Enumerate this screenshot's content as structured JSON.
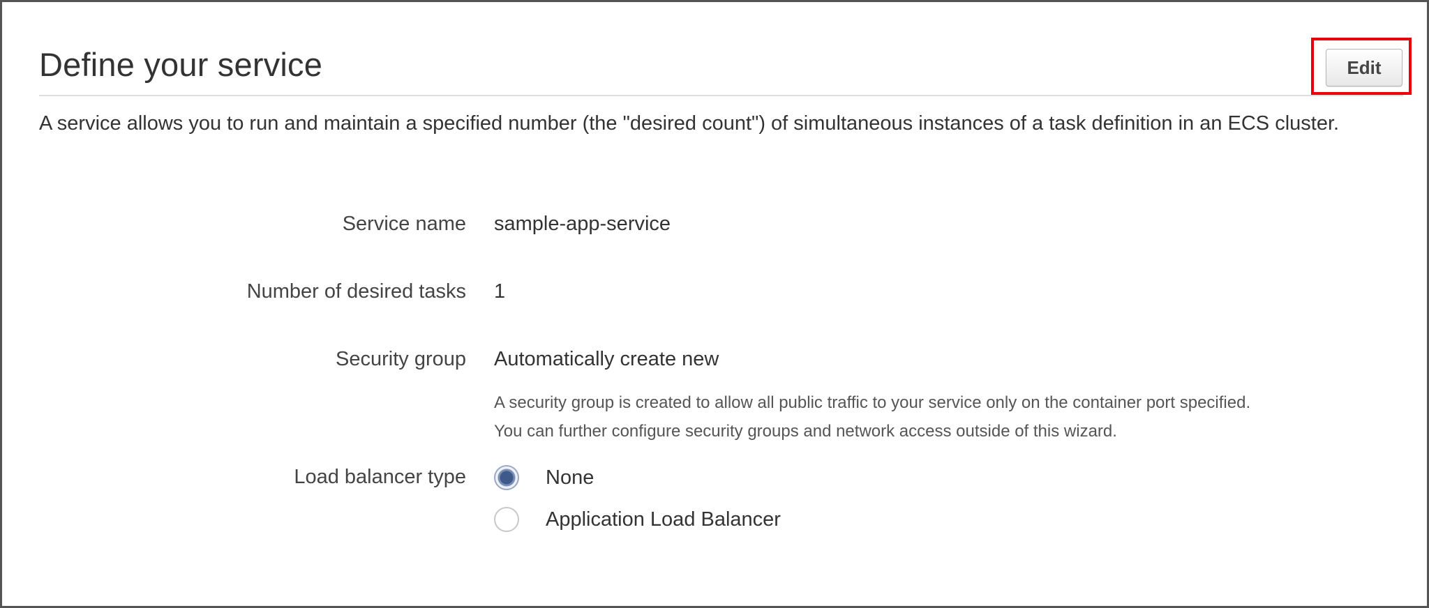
{
  "panel": {
    "title": "Define your service",
    "edit_label": "Edit",
    "description": "A service allows you to run and maintain a specified number (the \"desired count\") of simultaneous instances of a task definition in an ECS cluster."
  },
  "fields": {
    "service_name": {
      "label": "Service name",
      "value": "sample-app-service"
    },
    "desired_tasks": {
      "label": "Number of desired tasks",
      "value": "1"
    },
    "security_group": {
      "label": "Security group",
      "value": "Automatically create new",
      "help_line1": "A security group is created to allow all public traffic to your service only on the container port specified.",
      "help_line2": "You can further configure security groups and network access outside of this wizard."
    },
    "load_balancer": {
      "label": "Load balancer type",
      "options": [
        {
          "label": "None",
          "selected": true
        },
        {
          "label": "Application Load Balancer",
          "selected": false
        }
      ]
    }
  },
  "colors": {
    "highlight": "#e8000d",
    "radio_selected": "#3e5a8a"
  }
}
